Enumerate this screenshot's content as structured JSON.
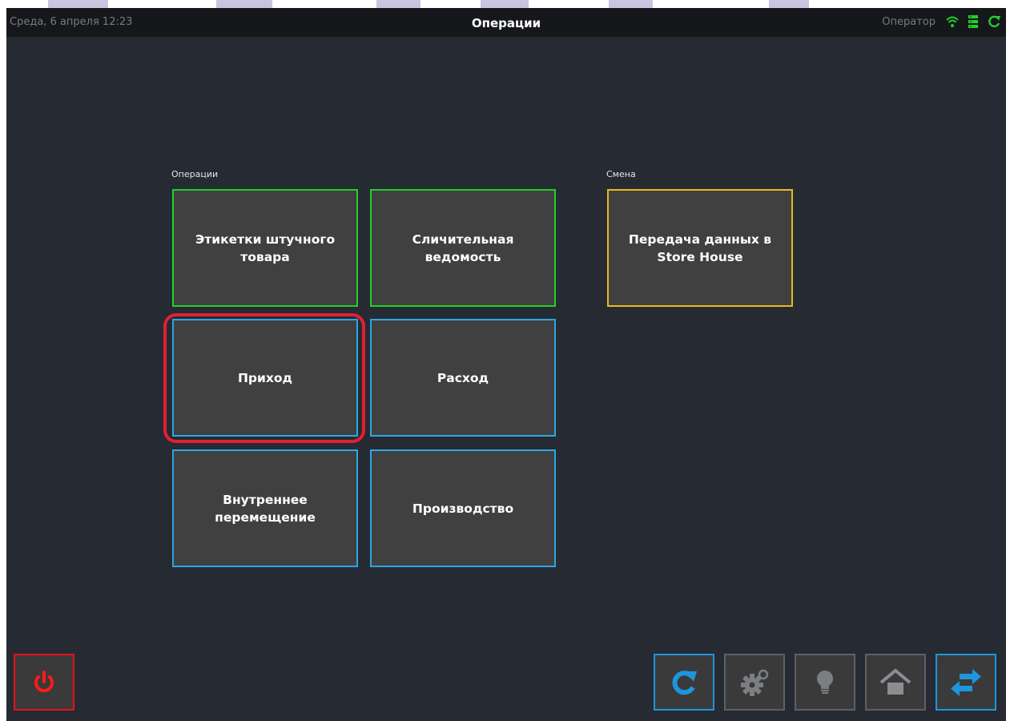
{
  "status_bar": {
    "date_time": "Среда, 6 апреля 12:23",
    "title": "Операции",
    "operator": "Оператор",
    "icons": [
      "wifi-icon",
      "server-icon",
      "sync-icon"
    ],
    "icon_color": "#1fd12a"
  },
  "sections": {
    "operations": {
      "label": "Операции",
      "tiles": [
        {
          "label": "Этикетки штучного товара",
          "color": "green"
        },
        {
          "label": "Сличительная ведомость",
          "color": "green"
        },
        {
          "label": "Приход",
          "color": "blue",
          "highlighted": true
        },
        {
          "label": "Расход",
          "color": "blue"
        },
        {
          "label": "Внутреннее перемещение",
          "color": "blue"
        },
        {
          "label": "Производство",
          "color": "blue"
        }
      ]
    },
    "shift": {
      "label": "Смена",
      "tiles": [
        {
          "label": "Передача данных в Store House",
          "color": "yellow"
        }
      ]
    }
  },
  "bottom_bar": {
    "left": [
      {
        "icon": "power-icon",
        "color": "#e5121b"
      }
    ],
    "right": [
      {
        "icon": "refresh-icon",
        "color": "#1e95dc"
      },
      {
        "icon": "settings-gears-icon",
        "color": "#5d6166"
      },
      {
        "icon": "lightbulb-icon",
        "color": "#5d6166"
      },
      {
        "icon": "home-icon",
        "color": "#5d6166"
      },
      {
        "icon": "swap-arrows-icon",
        "color": "#1e95dc"
      }
    ]
  },
  "colors": {
    "background": "#262a32",
    "tile_background": "#404040",
    "green_border": "#1fd12a",
    "blue_border": "#2aa7e6",
    "yellow_border": "#e9b91e",
    "highlight": "#e0202f"
  }
}
